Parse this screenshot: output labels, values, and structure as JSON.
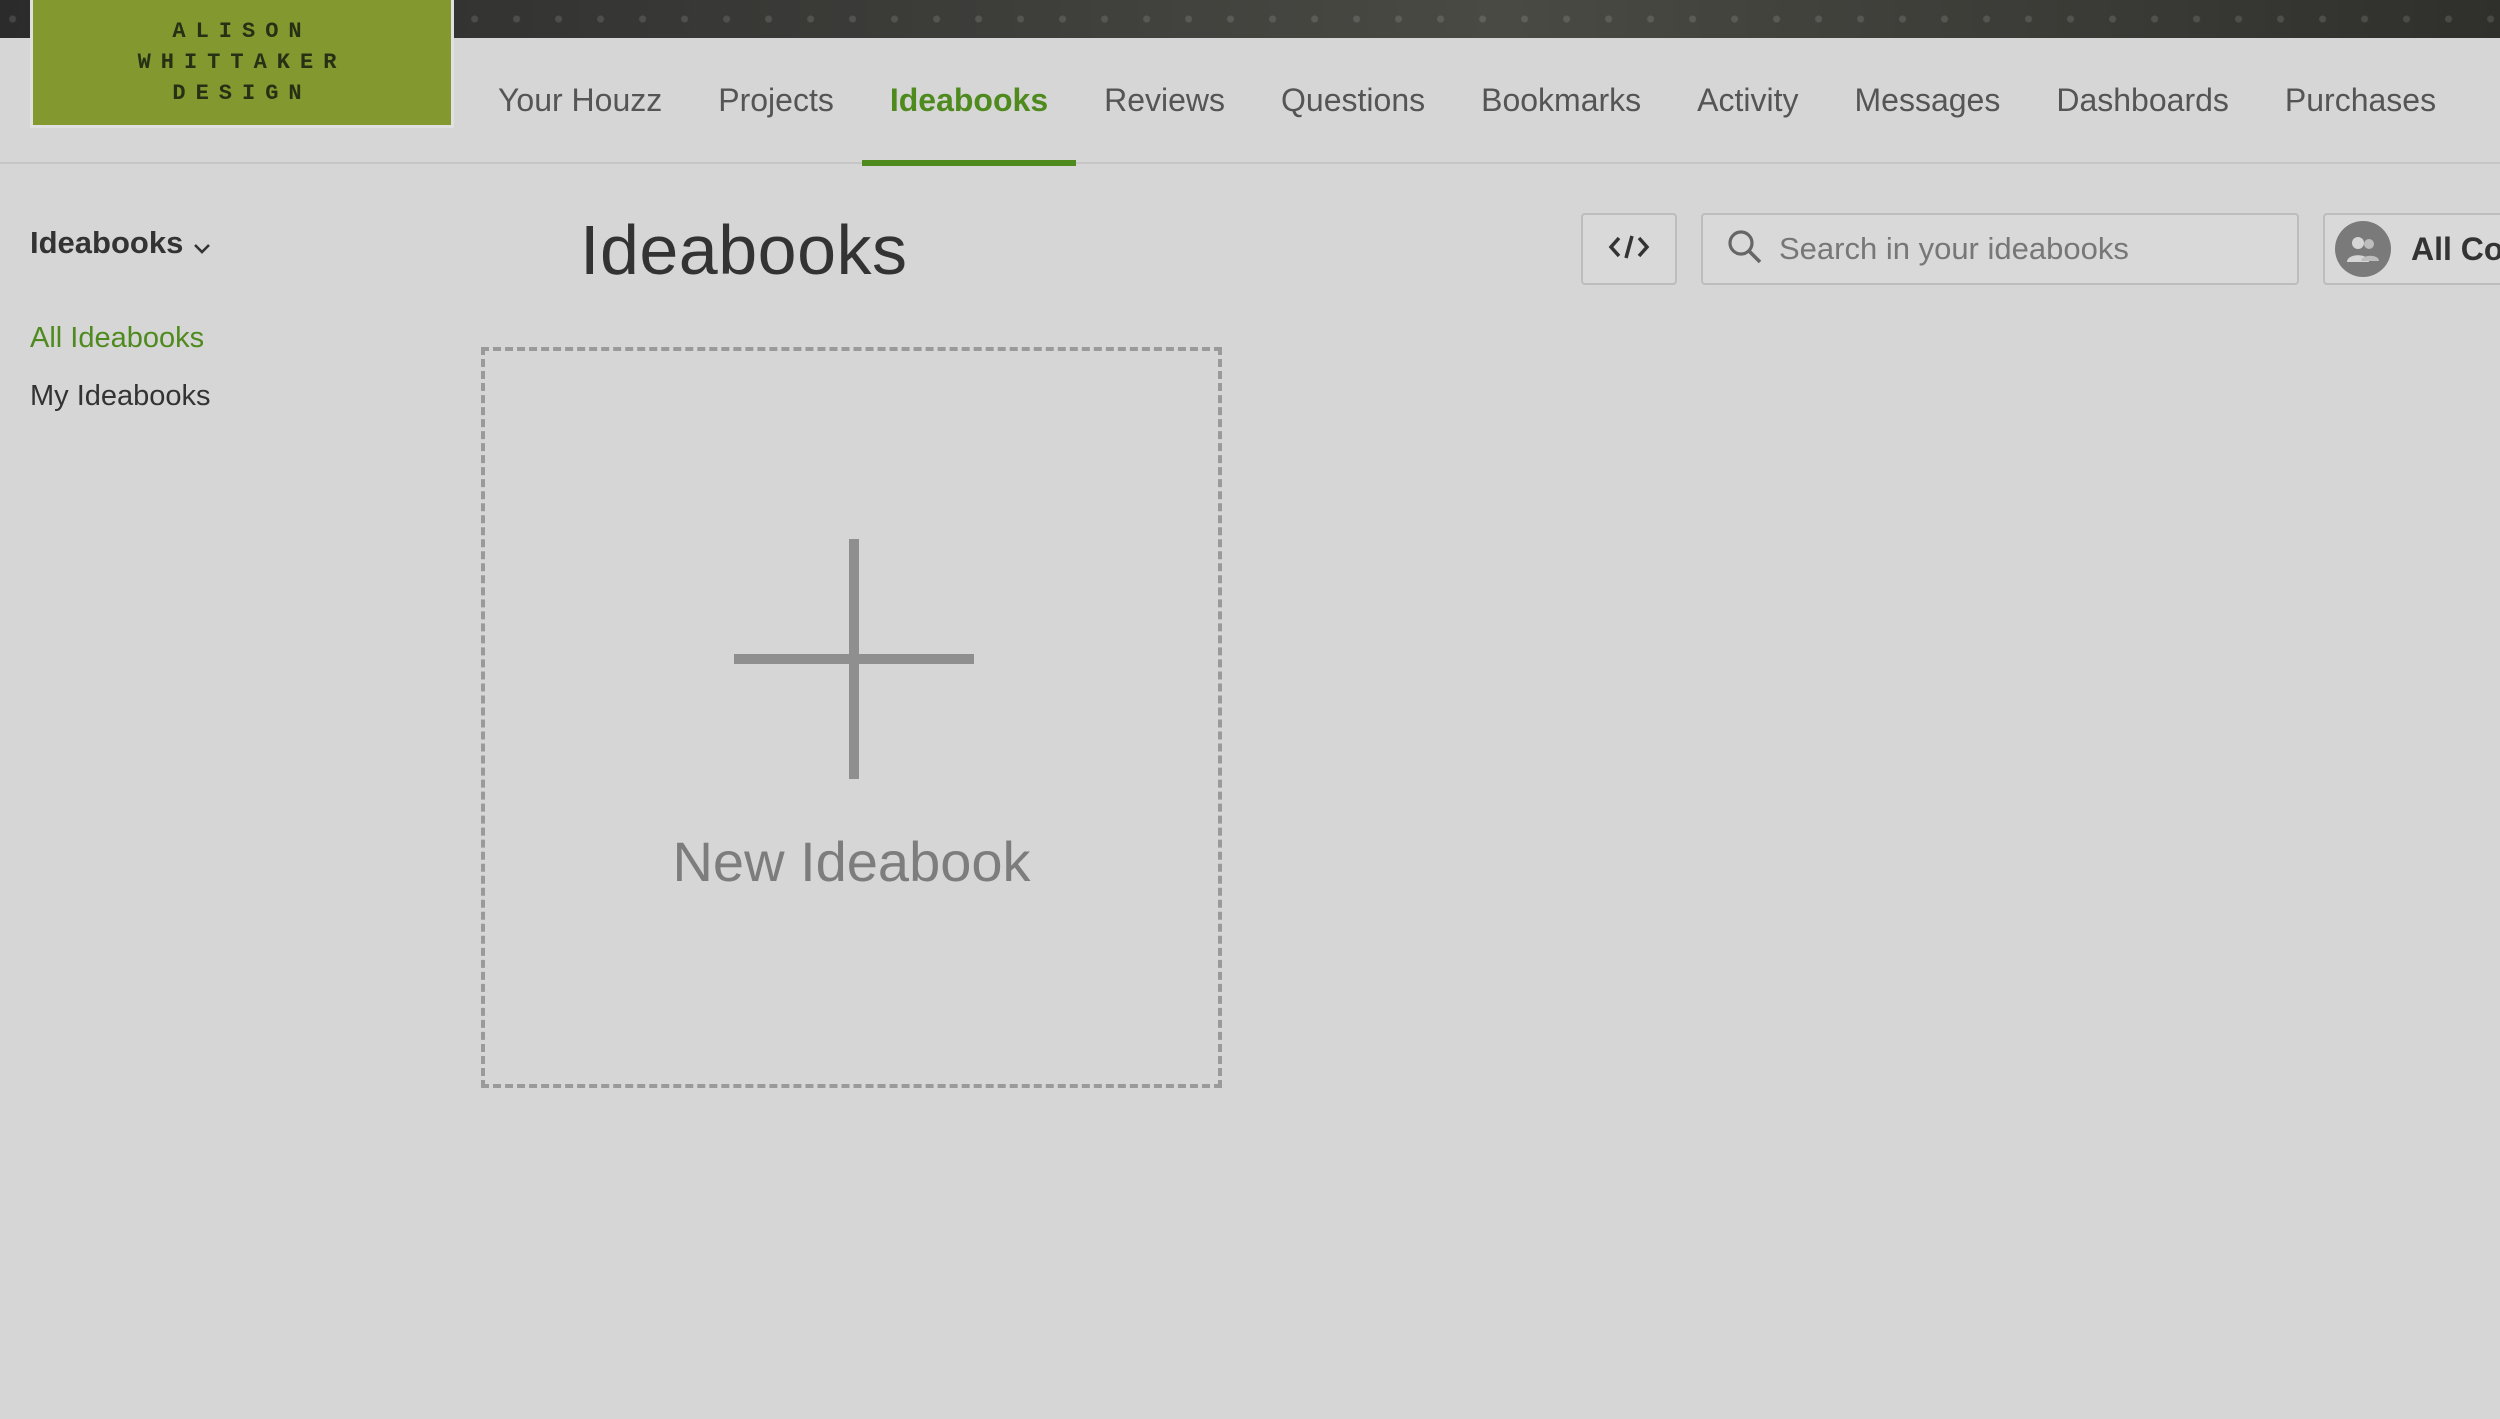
{
  "brand": {
    "logo_lines": [
      "ALISON",
      "WHITTAKER",
      "DESIGN"
    ],
    "logo_color": "#83992f"
  },
  "nav": {
    "tabs": [
      {
        "label": "Your Houzz",
        "active": false
      },
      {
        "label": "Projects",
        "active": false
      },
      {
        "label": "Ideabooks",
        "active": true
      },
      {
        "label": "Reviews",
        "active": false
      },
      {
        "label": "Questions",
        "active": false
      },
      {
        "label": "Bookmarks",
        "active": false
      },
      {
        "label": "Activity",
        "active": false
      },
      {
        "label": "Messages",
        "active": false
      },
      {
        "label": "Dashboards",
        "active": false
      },
      {
        "label": "Purchases",
        "active": false
      }
    ],
    "accent_color": "#4e8a1e"
  },
  "sidebar": {
    "heading": "Ideabooks",
    "heading_icon": "chevron-down-icon",
    "items": [
      {
        "label": "All Ideabooks",
        "active": true
      },
      {
        "label": "My Ideabooks",
        "active": false
      }
    ]
  },
  "main": {
    "title": "Ideabooks",
    "toolbar": {
      "embed_icon": "code-icon",
      "search": {
        "placeholder": "Search in your ideabooks",
        "value": "",
        "icon": "search-icon"
      },
      "collaborators": {
        "label": "All Co",
        "icon": "users-icon"
      }
    },
    "new_card": {
      "label": "New Ideabook",
      "icon": "plus-icon"
    }
  }
}
